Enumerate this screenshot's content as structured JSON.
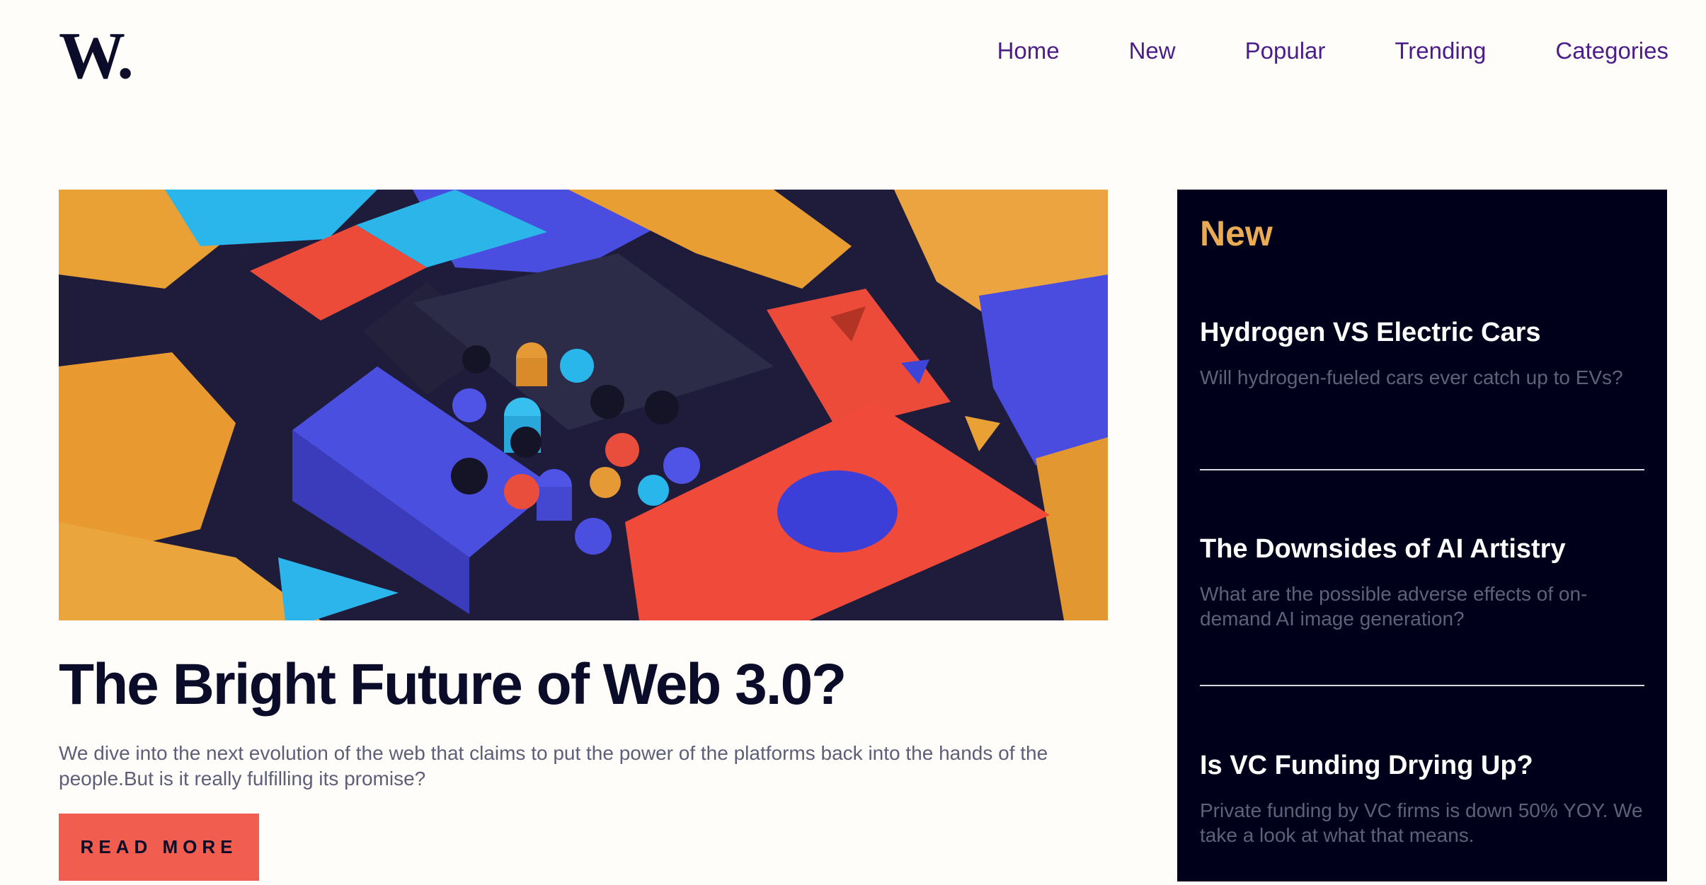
{
  "header": {
    "logo": "W.",
    "nav": [
      "Home",
      "New",
      "Popular",
      "Trending",
      "Categories"
    ]
  },
  "hero": {
    "image_description_icon": "abstract-3d-blocks-image",
    "title": "The Bright Future of Web 3.0?",
    "summary": "We dive into the next evolution of the web that claims to put the power of the platforms back into the hands of the people.But is it really fulfilling its promise?",
    "cta": "READ MORE"
  },
  "sidebar": {
    "title": "New",
    "items": [
      {
        "title": "Hydrogen VS Electric Cars",
        "desc": "Will hydrogen-fueled cars ever catch up to EVs?"
      },
      {
        "title": "The Downsides of AI Artistry",
        "desc": "What are the possible adverse effects of on-demand AI image generation?"
      },
      {
        "title": "Is VC Funding Drying Up?",
        "desc": "Private funding by VC firms is down 50% YOY. We take a look at what that means."
      }
    ]
  },
  "colors": {
    "background": "#fffdf9",
    "text_dark": "#0b0c2a",
    "nav": "#4b1d88",
    "accent_red": "#f15e50",
    "sidebar_bg": "#00001a",
    "sidebar_title": "#e9ab53"
  }
}
